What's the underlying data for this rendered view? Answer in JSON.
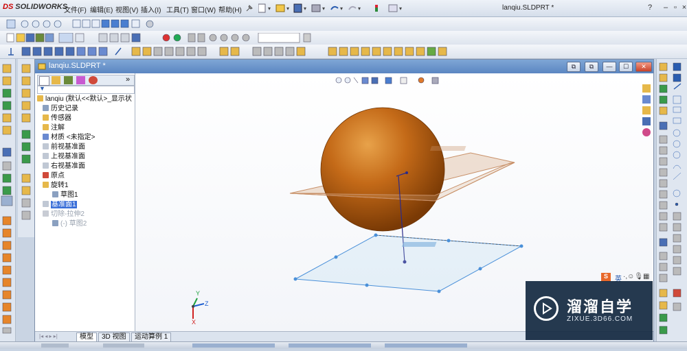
{
  "app": {
    "logo_text": "SOLIDWORKS",
    "logo_mark": "DS",
    "document_title": "lanqiu.SLDPRT *"
  },
  "menu": [
    "文件(F)",
    "编辑(E)",
    "视图(V)",
    "插入(I)",
    "工具(T)",
    "窗口(W)",
    "帮助(H)"
  ],
  "document_window": {
    "title": "lanqiu.SLDPRT *",
    "controls": [
      "⧉",
      "⧉",
      "—",
      "☐",
      "✕"
    ]
  },
  "feature_tree": {
    "collapse_label": "»",
    "rows": [
      {
        "label": "lanqiu (默认<<默认>_显示状",
        "indent": 0,
        "state": "normal",
        "icon": "part-icon"
      },
      {
        "label": "历史记录",
        "indent": 1,
        "state": "normal",
        "icon": "history-icon"
      },
      {
        "label": "传感器",
        "indent": 1,
        "state": "normal",
        "icon": "sensor-icon"
      },
      {
        "label": "注解",
        "indent": 1,
        "state": "normal",
        "icon": "annotation-icon"
      },
      {
        "label": "材质 <未指定>",
        "indent": 1,
        "state": "normal",
        "icon": "material-icon"
      },
      {
        "label": "前视基准面",
        "indent": 1,
        "state": "normal",
        "icon": "plane-icon"
      },
      {
        "label": "上视基准面",
        "indent": 1,
        "state": "normal",
        "icon": "plane-icon"
      },
      {
        "label": "右视基准面",
        "indent": 1,
        "state": "normal",
        "icon": "plane-icon"
      },
      {
        "label": "原点",
        "indent": 1,
        "state": "normal",
        "icon": "origin-icon"
      },
      {
        "label": "旋转1",
        "indent": 1,
        "state": "normal",
        "icon": "revolve-icon"
      },
      {
        "label": "草图1",
        "indent": 2,
        "state": "normal",
        "icon": "sketch-icon"
      },
      {
        "label": "基准面1",
        "indent": 1,
        "state": "selected",
        "icon": "plane-icon"
      },
      {
        "label": "切除-拉伸2",
        "indent": 1,
        "state": "dim",
        "icon": "cut-extrude-icon"
      },
      {
        "label": "(-) 草图2",
        "indent": 2,
        "state": "dim",
        "icon": "sketch-icon"
      }
    ]
  },
  "bottom_tabs": [
    "模型",
    "3D 视图",
    "运动算例 1"
  ],
  "triad": {
    "x": "X",
    "y": "Y",
    "z": "Z"
  },
  "watermark": {
    "title": "溜溜自学",
    "url": "ZIXUE.3D66.COM"
  },
  "ime": {
    "label": "英"
  },
  "colors": {
    "sphere": "#b55a10",
    "plane_selected": "#4a90d9",
    "plane_reference": "#c88a5a",
    "title_bar_blue": "#5b86c2"
  }
}
